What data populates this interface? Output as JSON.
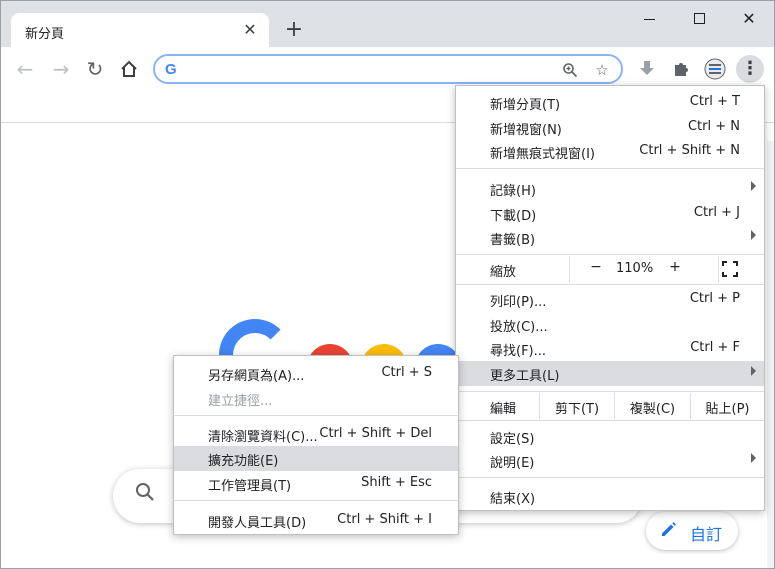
{
  "tab": {
    "title": "新分頁"
  },
  "omnibox": {
    "value": "",
    "logo": "G"
  },
  "icons": {
    "back": "arrow-left-icon",
    "forward": "arrow-right-icon",
    "reload": "reload-icon",
    "home": "home-icon",
    "zoom": "zoom-icon",
    "bookmark": "star-icon",
    "download": "download-icon",
    "extensions": "puzzle-icon",
    "profile": "profile-icon",
    "menu": "three-dots-icon",
    "search": "search-icon",
    "pencil": "pencil-icon"
  },
  "logo_colors": [
    "#4285f4",
    "#ea4335",
    "#fbbc05",
    "#4285f4"
  ],
  "customize": {
    "label": "自訂"
  },
  "menu": {
    "new_tab": {
      "label": "新增分頁(T)",
      "shortcut": "Ctrl + T"
    },
    "new_window": {
      "label": "新增視窗(N)",
      "shortcut": "Ctrl + N"
    },
    "incognito": {
      "label": "新增無痕式視窗(I)",
      "shortcut": "Ctrl + Shift + N"
    },
    "history": {
      "label": "記錄(H)"
    },
    "downloads": {
      "label": "下載(D)",
      "shortcut": "Ctrl + J"
    },
    "bookmarks": {
      "label": "書籤(B)"
    },
    "zoom": {
      "label": "縮放",
      "minus": "−",
      "value": "110%",
      "plus": "+"
    },
    "print": {
      "label": "列印(P)...",
      "shortcut": "Ctrl + P"
    },
    "cast": {
      "label": "投放(C)..."
    },
    "find": {
      "label": "尋找(F)...",
      "shortcut": "Ctrl + F"
    },
    "more_tools": {
      "label": "更多工具(L)"
    },
    "edit": {
      "label": "編輯",
      "cut": "剪下(T)",
      "copy": "複製(C)",
      "paste": "貼上(P)"
    },
    "settings": {
      "label": "設定(S)"
    },
    "help": {
      "label": "說明(E)"
    },
    "exit": {
      "label": "結束(X)"
    }
  },
  "submenu": {
    "save_page": {
      "label": "另存網頁為(A)...",
      "shortcut": "Ctrl + S"
    },
    "create_shortcut": {
      "label": "建立捷徑..."
    },
    "clear_data": {
      "label": "清除瀏覽資料(C)...",
      "shortcut": "Ctrl + Shift + Del"
    },
    "extensions": {
      "label": "擴充功能(E)"
    },
    "task_manager": {
      "label": "工作管理員(T)",
      "shortcut": "Shift + Esc"
    },
    "dev_tools": {
      "label": "開發人員工具(D)",
      "shortcut": "Ctrl + Shift + I"
    }
  }
}
